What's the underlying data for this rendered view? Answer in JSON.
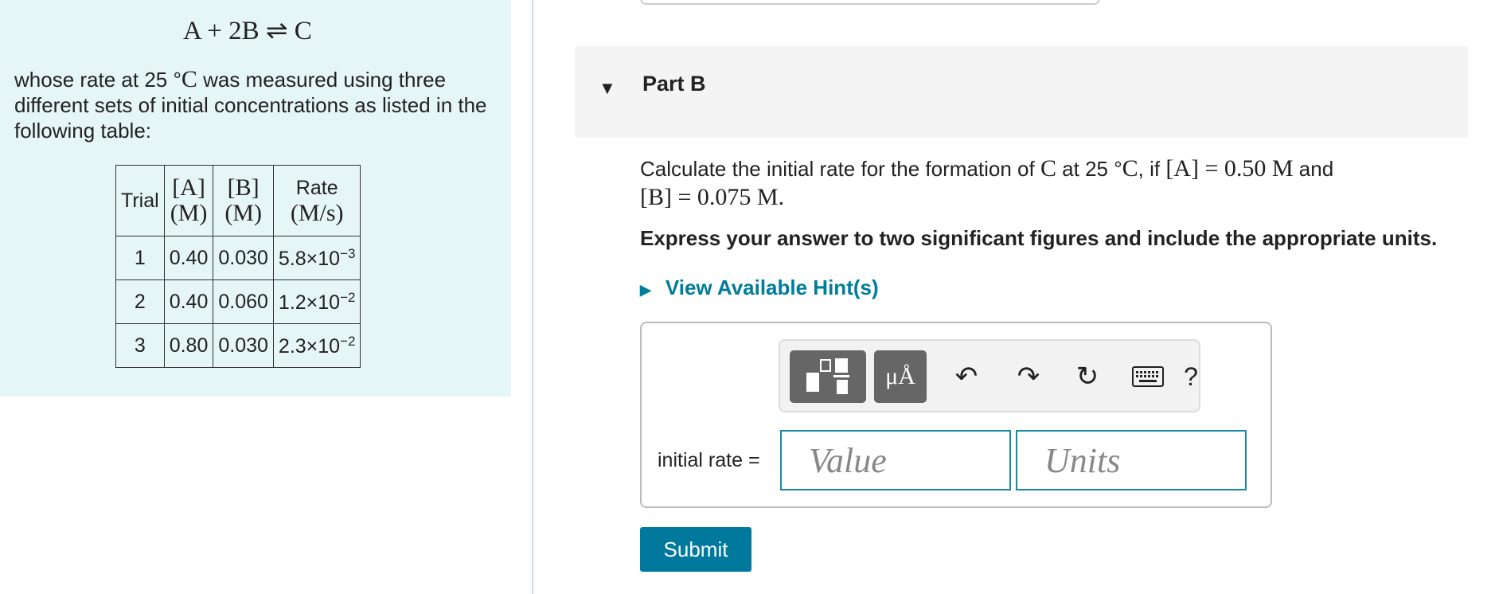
{
  "context": {
    "reaction": "A + 2B ⇌ C",
    "intro_before": "whose rate at 25 °",
    "intro_var": "C",
    "intro_after": " was measured using three different sets of initial concentrations as listed in the following table:"
  },
  "table": {
    "headers": {
      "trial": "Trial",
      "a_top": "[A]",
      "a_bottom": "(M)",
      "b_top": "[B]",
      "b_bottom": "(M)",
      "rate_top": "Rate",
      "rate_bottom": "(M/s)"
    },
    "rows": [
      {
        "trial": "1",
        "a": "0.40",
        "b": "0.030",
        "rate_base": "5.8×10",
        "rate_exp": "−3"
      },
      {
        "trial": "2",
        "a": "0.40",
        "b": "0.060",
        "rate_base": "1.2×10",
        "rate_exp": "−2"
      },
      {
        "trial": "3",
        "a": "0.80",
        "b": "0.030",
        "rate_base": "2.3×10",
        "rate_exp": "−2"
      }
    ]
  },
  "part": {
    "title": "Part B",
    "question_1": "Calculate the initial rate for the formation of ",
    "question_c": "C",
    "question_2": " at 25 °",
    "question_c2": "C",
    "question_3": ", if ",
    "question_a_expr": "[A] = 0.50 M",
    "question_4": " and",
    "question_b_expr": "[B] = 0.075 M.",
    "instruction": "Express your answer to two significant figures and include the appropriate units.",
    "hints_label": "View Available Hint(s)"
  },
  "toolbar": {
    "units_label": "μÅ",
    "undo_glyph": "↶",
    "redo_glyph": "↷",
    "reset_glyph": "↻",
    "help_label": "?"
  },
  "answer": {
    "label": "initial rate =",
    "value_placeholder": "Value",
    "units_placeholder": "Units",
    "value": "",
    "units": ""
  },
  "submit_label": "Submit",
  "colors": {
    "left_panel_bg": "#e6f5f6",
    "accent": "#00799c",
    "input_border": "#1a8aa5"
  }
}
